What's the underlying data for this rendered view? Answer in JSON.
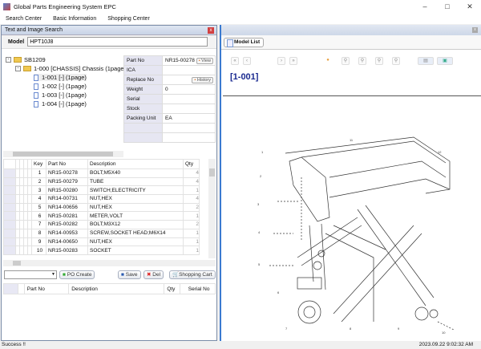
{
  "window": {
    "title": "Global Parts Engineering System EPC"
  },
  "menu": [
    "Search Center",
    "Basic Information",
    "Shopping Center"
  ],
  "search_panel": {
    "title": "Text and Image Search",
    "model_label": "Model",
    "model_value": "HPT10J8",
    "tree": {
      "root": "SB1209",
      "group": "1-000 [CHASSIS] Chassis (1page",
      "pages": [
        "1-001 [-]   (1page)",
        "1-002 [-]   (1page)",
        "1-003 [-]   (1page)",
        "1-004 [-]   (1page)"
      ]
    },
    "props": [
      {
        "k": "Part No",
        "v": "NR15-00278",
        "btn": "View"
      },
      {
        "k": "ICA",
        "v": ""
      },
      {
        "k": "Replace No",
        "v": "",
        "btn": "History"
      },
      {
        "k": "Weight",
        "v": "0"
      },
      {
        "k": "Serial",
        "v": ""
      },
      {
        "k": "Stock",
        "v": ""
      },
      {
        "k": "Packing Unit",
        "v": "EA"
      },
      {
        "k": "",
        "v": ""
      },
      {
        "k": "",
        "v": ""
      }
    ],
    "grid": {
      "headers": [
        "Key",
        "Part No",
        "Description",
        "Qty"
      ],
      "rows": [
        [
          "1",
          "NR15-00278",
          "BOLT;M5X40",
          "4"
        ],
        [
          "2",
          "NR15-00279",
          "TUBE",
          "4"
        ],
        [
          "3",
          "NR15-00280",
          "SWITCH;ELECTRICITY",
          "1"
        ],
        [
          "4",
          "NR14-00731",
          "NUT,HEX",
          "4"
        ],
        [
          "5",
          "NR14-00656",
          "NUT,HEX",
          "2"
        ],
        [
          "6",
          "NR15-00281",
          "METER,VOLT",
          "1"
        ],
        [
          "7",
          "NR15-00282",
          "BOLT;M3X12",
          "2"
        ],
        [
          "8",
          "NR14-00953",
          "SCREW,SOCKET HEAD;M6X14",
          "1"
        ],
        [
          "9",
          "NR14-00650",
          "NUT,HEX",
          "1"
        ],
        [
          "10",
          "NR15-00283",
          "SOCKET",
          "1"
        ]
      ]
    },
    "buttons": {
      "po_create": "PO Create",
      "save": "Save",
      "del": "Del",
      "cart": "Shopping Cart"
    },
    "cart_headers": [
      "Part No",
      "Description",
      "Qty",
      "Serial No"
    ]
  },
  "viewer": {
    "tab": "Model List",
    "page_label": "[1-001]"
  },
  "status": {
    "message": "Success !!",
    "timestamp": "2023.09.22 9:02:32 AM"
  }
}
